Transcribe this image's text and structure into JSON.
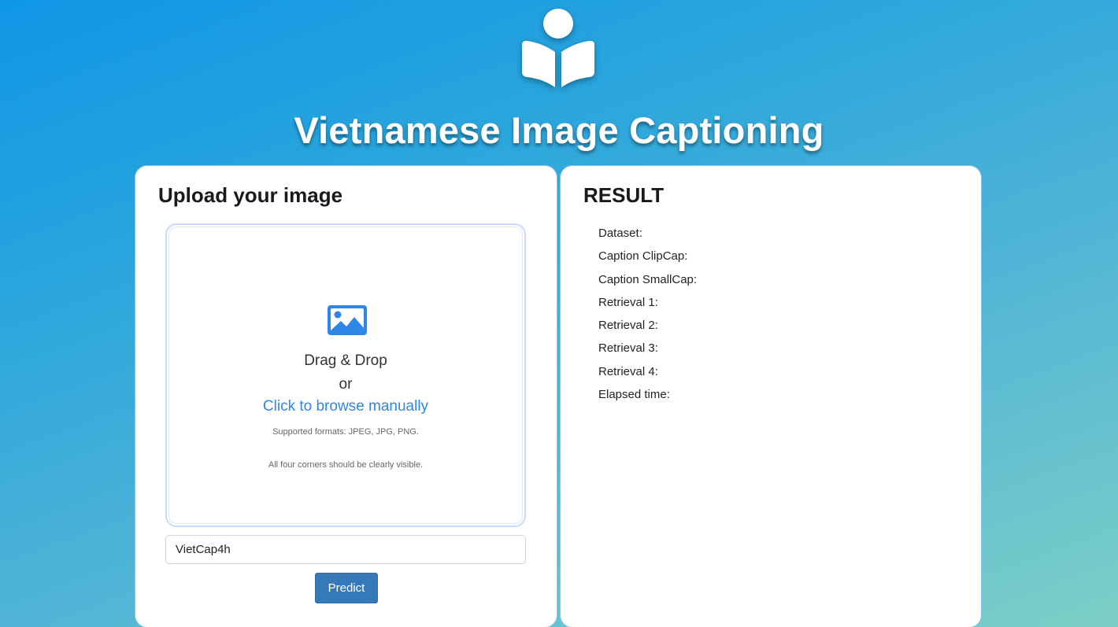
{
  "header": {
    "logo_icon": "reading-person-icon",
    "title": "Vietnamese Image Captioning"
  },
  "upload": {
    "heading": "Upload your image",
    "dropzone": {
      "icon": "image-icon",
      "drag_text": "Drag & Drop",
      "or_text": "or",
      "browse_text": "Click to browse manually",
      "formats_text": "Supported formats: JPEG, JPG, PNG.",
      "corners_text": "All four corners should be clearly visible."
    },
    "dataset_value": "VietCap4h",
    "predict_label": "Predict"
  },
  "result": {
    "heading": "RESULT",
    "fields": [
      "Dataset:",
      "Caption ClipCap:",
      "Caption SmallCap:",
      "Retrieval 1:",
      "Retrieval 2:",
      "Retrieval 3:",
      "Retrieval 4:",
      "Elapsed time:"
    ]
  },
  "colors": {
    "accent": "#2d87e6",
    "button": "#3579b8",
    "bg_start": "#0f96e6",
    "bg_end": "#7ccfc6"
  }
}
